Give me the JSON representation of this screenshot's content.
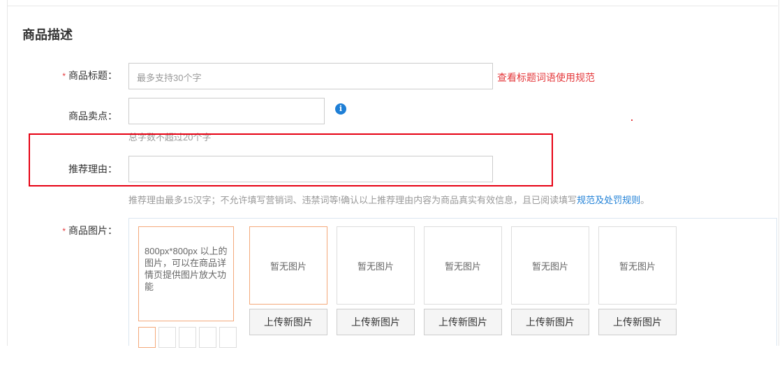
{
  "section": {
    "title": "商品描述"
  },
  "fields": {
    "title": {
      "required_mark": "*",
      "label": "商品标题：",
      "placeholder": "最多支持30个字",
      "value": "",
      "rules_link": "查看标题词语使用规范"
    },
    "selling_point": {
      "label": "商品卖点：",
      "value": "",
      "info_icon": "i",
      "hint": "总字数不超过20个字"
    },
    "reason": {
      "label": "推荐理由：",
      "value": "",
      "hint_prefix": "推荐理由最多15汉字；不允许填写营销词、违禁词等!确认以上推荐理由内容为商品真实有效信息，且已阅读填写",
      "hint_link": "规范及处罚规则",
      "hint_suffix": "。"
    },
    "images": {
      "required_mark": "*",
      "label": "商品图片：",
      "main_note": "800px*800px 以上的图片，可以在商品详情页提供图片放大功能",
      "slots": [
        {
          "empty_text": "暂无图片",
          "upload_label": "上传新图片"
        },
        {
          "empty_text": "暂无图片",
          "upload_label": "上传新图片"
        },
        {
          "empty_text": "暂无图片",
          "upload_label": "上传新图片"
        },
        {
          "empty_text": "暂无图片",
          "upload_label": "上传新图片"
        },
        {
          "empty_text": "暂无图片",
          "upload_label": "上传新图片"
        }
      ]
    }
  },
  "colors": {
    "required": "#e4393c",
    "link_blue": "#1e7fd6",
    "highlight_box": "#e60012",
    "accent_border": "#f4a97a"
  }
}
